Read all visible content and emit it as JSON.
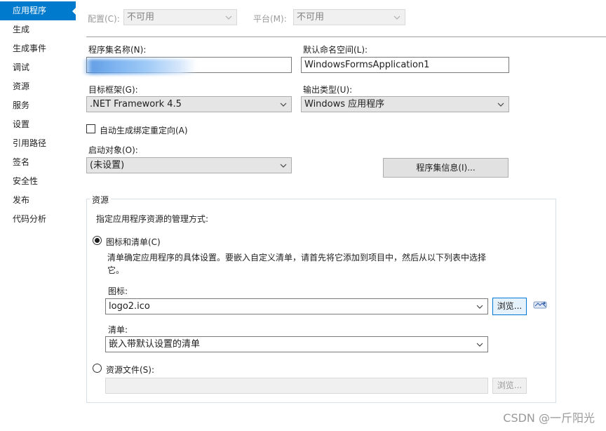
{
  "sidebar": {
    "items": [
      {
        "label": "应用程序"
      },
      {
        "label": "生成"
      },
      {
        "label": "生成事件"
      },
      {
        "label": "调试"
      },
      {
        "label": "资源"
      },
      {
        "label": "服务"
      },
      {
        "label": "设置"
      },
      {
        "label": "引用路径"
      },
      {
        "label": "签名"
      },
      {
        "label": "安全性"
      },
      {
        "label": "发布"
      },
      {
        "label": "代码分析"
      }
    ],
    "active_index": 0
  },
  "toolbar": {
    "config_label": "配置(C):",
    "config_value": "不可用",
    "platform_label": "平台(M):",
    "platform_value": "不可用"
  },
  "assembly": {
    "name_label": "程序集名称(N):",
    "name_value": "",
    "namespace_label": "默认命名空间(L):",
    "namespace_value": "WindowsFormsApplication1",
    "framework_label": "目标框架(G):",
    "framework_value": ".NET Framework 4.5",
    "output_label": "输出类型(U):",
    "output_value": "Windows 应用程序",
    "auto_binding_label": "自动生成绑定重定向(A)",
    "auto_binding_checked": false,
    "startup_label": "启动对象(O):",
    "startup_value": "(未设置)",
    "info_button": "程序集信息(I)..."
  },
  "resources": {
    "group_title": "资源",
    "description": "指定应用程序资源的管理方式:",
    "option_icon_manifest": "图标和清单(C)",
    "option_icon_manifest_selected": true,
    "manifest_hint_line1": "清单确定应用程序的具体设置。要嵌入自定义清单，请首先将它添加到项目中，然后从以下列表中选择",
    "manifest_hint_line2": "它。",
    "icon_label": "图标:",
    "icon_value": "logo2.ico",
    "browse_button": "浏览...",
    "manifest_label": "清单:",
    "manifest_value": "嵌入带默认设置的清单",
    "option_resource_file": "资源文件(S):",
    "resource_file_value": "",
    "browse_button_disabled": "浏览..."
  },
  "watermark": "CSDN @一斤阳光",
  "colors": {
    "accent": "#007acc",
    "border": "#7a7a7a",
    "disabled_text": "#9a9a9a"
  }
}
